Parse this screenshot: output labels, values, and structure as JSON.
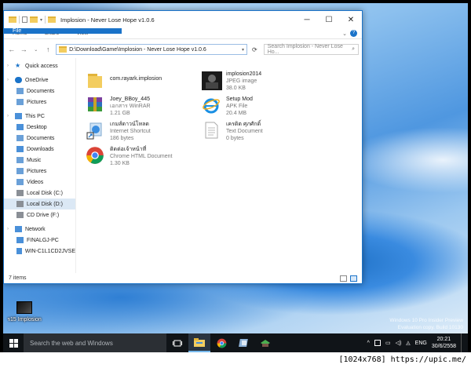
{
  "window": {
    "title": "Implosion - Never Lose Hope v1.0.6",
    "controls": {
      "minimize": "─",
      "maximize": "☐",
      "close": "✕"
    }
  },
  "ribbon": {
    "tabs": [
      "File",
      "Home",
      "Share",
      "View"
    ],
    "expand": "⌄",
    "help": "?"
  },
  "address": {
    "path": "D:\\Download\\Game\\Implosion - Never Lose Hope v1.0.6",
    "search_placeholder": "Search Implosion - Never Lose Ho...",
    "back": "←",
    "forward": "→",
    "recent": "⌄",
    "up": "↑",
    "refresh": "⟳"
  },
  "sidebar": {
    "items": [
      {
        "label": "Quick access",
        "level": 0,
        "icon": "star-icon"
      },
      {
        "label": "OneDrive",
        "level": 0,
        "icon": "cloud-icon"
      },
      {
        "label": "Documents",
        "level": 1,
        "icon": "documents-folder-icon"
      },
      {
        "label": "Pictures",
        "level": 1,
        "icon": "pictures-folder-icon"
      },
      {
        "label": "This PC",
        "level": 0,
        "icon": "computer-icon"
      },
      {
        "label": "Desktop",
        "level": 1,
        "icon": "desktop-folder-icon"
      },
      {
        "label": "Documents",
        "level": 1,
        "icon": "documents-folder-icon"
      },
      {
        "label": "Downloads",
        "level": 1,
        "icon": "downloads-folder-icon"
      },
      {
        "label": "Music",
        "level": 1,
        "icon": "music-folder-icon"
      },
      {
        "label": "Pictures",
        "level": 1,
        "icon": "pictures-folder-icon"
      },
      {
        "label": "Videos",
        "level": 1,
        "icon": "videos-folder-icon"
      },
      {
        "label": "Local Disk (C:)",
        "level": 1,
        "icon": "drive-icon"
      },
      {
        "label": "Local Disk (D:)",
        "level": 1,
        "icon": "drive-icon",
        "selected": true
      },
      {
        "label": "CD Drive (F:)",
        "level": 1,
        "icon": "cd-drive-icon"
      },
      {
        "label": "Network",
        "level": 0,
        "icon": "network-icon"
      },
      {
        "label": "FINALGJ-PC",
        "level": 1,
        "icon": "monitor-icon"
      },
      {
        "label": "WIN-C1L1CD2JVSE",
        "level": 1,
        "icon": "monitor-icon"
      }
    ]
  },
  "files": [
    {
      "name": "com.rayark.implosion",
      "sub1": "",
      "sub2": "",
      "icon": "folder-icon"
    },
    {
      "name": "implosion2014",
      "sub1": "JPEG image",
      "sub2": "38.0 KB",
      "icon": "image-thumbnail-icon"
    },
    {
      "name": "Joey_BBoy_445",
      "sub1": "เอกสาร WinRAR",
      "sub2": "1.21 GB",
      "icon": "winrar-archive-icon"
    },
    {
      "name": "Setup Mod",
      "sub1": "APK File",
      "sub2": "20.4 MB",
      "icon": "internet-explorer-icon"
    },
    {
      "name": "เกมส์ดาวน์โหลด",
      "sub1": "Internet Shortcut",
      "sub2": "186 bytes",
      "icon": "internet-shortcut-icon"
    },
    {
      "name": "เครดิต ศุภศักดิ์",
      "sub1": "Text Document",
      "sub2": "0 bytes",
      "icon": "text-document-icon"
    },
    {
      "name": "ติดต่อเจ้าหน้าที่",
      "sub1": "Chrome HTML Document",
      "sub2": "1.30 KB",
      "icon": "chrome-icon"
    }
  ],
  "status": {
    "items_count": "7 items"
  },
  "desktop": {
    "icon_label": "ร15 Implosion",
    "watermark_line1": "Windows 10 Pro Insider Preview",
    "watermark_line2": "Evaluation copy. Build 10130"
  },
  "taskbar": {
    "search_placeholder": "Search the web and Windows",
    "language": "ENG",
    "time": "20:21",
    "date": "30/6/2558"
  },
  "footer": {
    "text": "[1024x768] https://upic.me/"
  },
  "colors": {
    "accent": "#1a73c9",
    "taskbar": "#101418",
    "selection": "#dbe8f5"
  }
}
